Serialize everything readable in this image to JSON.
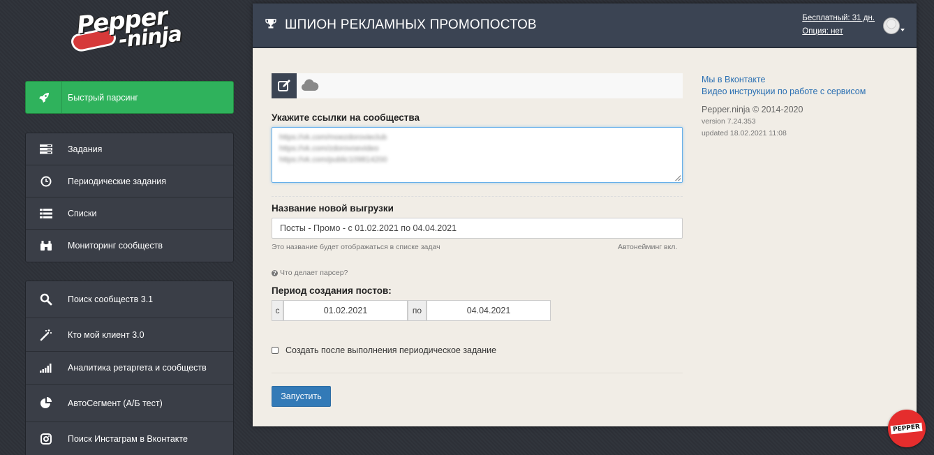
{
  "logo": {
    "line1": "Pepper",
    "line2": "-ninja"
  },
  "sidebar": {
    "fast_parse": {
      "label": "Быстрый парсинг",
      "icon": "rocket-icon"
    },
    "group1": [
      {
        "label": "Задания",
        "icon": "tasks-icon"
      },
      {
        "label": "Периодические задания",
        "icon": "clock-icon"
      },
      {
        "label": "Списки",
        "icon": "list-icon"
      },
      {
        "label": "Мониторинг сообществ",
        "icon": "binoculars-icon"
      }
    ],
    "group2": [
      {
        "label": "Поиск сообществ 3.1",
        "icon": "search-icon"
      },
      {
        "label": "Кто мой клиент 3.0",
        "icon": "magic-wand-icon"
      },
      {
        "label": "Аналитика ретаргета и сообществ",
        "icon": "signal-bars-icon"
      },
      {
        "label": "АвтоСегмент (А/Б тест)",
        "icon": "pie-chart-icon"
      },
      {
        "label": "Поиск Инстаграм в Вконтакте",
        "icon": "instagram-icon"
      }
    ]
  },
  "header": {
    "title": "ШПИОН РЕКЛАМНЫХ ПРОМОПОСТОВ",
    "plan": "Бесплатный: 31 дн.",
    "option": "Опция: нет"
  },
  "form": {
    "communities_label": "Укажите ссылки на сообщества",
    "communities_lines": [
      "https://vk.com/moezdorovieclub",
      "https://vk.com/zdorovoevideo",
      "https://vk.com/public109814200"
    ],
    "name_label": "Название новой выгрузки",
    "name_value": "Посты - Промо - с 01.02.2021 по 04.04.2021",
    "name_hint": "Это название будет отображаться в списке задач",
    "autonaming": "Автонейминг вкл.",
    "help_text": "Что делает парсер?",
    "period_label": "Период создания постов:",
    "from_prefix": "с",
    "from_date": "01.02.2021",
    "to_prefix": "по",
    "to_date": "04.04.2021",
    "periodic_checkbox": "Создать после выполнения периодическое задание",
    "submit": "Запустить"
  },
  "info": {
    "vk_link": "Мы в Вконтакте",
    "video_link": "Видео инструкции по работе с сервисом",
    "copyright": "Pepper.ninja © 2014-2020",
    "version": "version 7.24.353",
    "updated": "updated 18.02.2021 11:08"
  },
  "badge": {
    "label": "PEPPER"
  }
}
